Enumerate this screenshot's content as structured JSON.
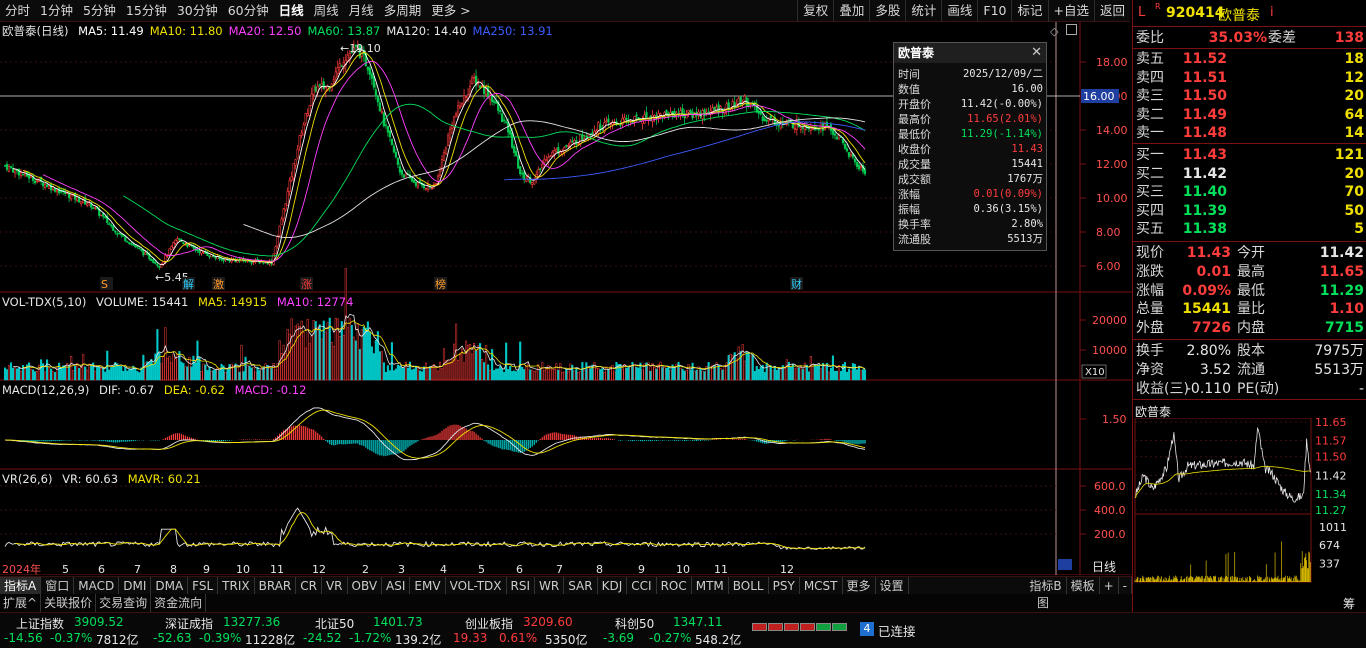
{
  "toolbar": {
    "periods": [
      "分时",
      "1分钟",
      "5分钟",
      "15分钟",
      "30分钟",
      "60分钟",
      "日线",
      "周线",
      "月线",
      "多周期",
      "更多 >"
    ],
    "active_period": "日线",
    "tools": [
      "复权",
      "叠加",
      "多股",
      "统计",
      "画线",
      "F10",
      "标记",
      "+自选",
      "返回"
    ]
  },
  "main": {
    "stock_label": "欧普泰(日线)",
    "ma": [
      {
        "label": "MA5: 11.49",
        "color": "#ffffff"
      },
      {
        "label": "MA10: 11.80",
        "color": "#f0e000"
      },
      {
        "label": "MA20: 12.50",
        "color": "#ff40ff"
      },
      {
        "label": "MA60: 13.87",
        "color": "#00e05a"
      },
      {
        "label": "MA120: 14.40",
        "color": "#e6e6e6"
      },
      {
        "label": "MA250: 13.91",
        "color": "#3b5bff"
      }
    ],
    "high_mark": "19.10",
    "low_mark": "5.45",
    "crosshair_price": "16.00",
    "y_ticks": [
      "18.00",
      "16.00",
      "14.00",
      "12.00",
      "10.00",
      "8.00",
      "6.00"
    ],
    "events": [
      "S",
      "解",
      "激",
      "涨",
      "榜",
      "财"
    ]
  },
  "volume": {
    "title": "VOL-TDX(5,10)",
    "values": [
      "VOLUME: 15441",
      "MA5: 14915",
      "MA10: 12774"
    ],
    "y_ticks": [
      "20000",
      "10000"
    ],
    "unit": "X10"
  },
  "macd": {
    "title": "MACD(12,26,9)",
    "values": [
      "DIF: -0.67",
      "DEA: -0.62",
      "MACD: -0.12"
    ],
    "y_ticks": [
      "1.50"
    ]
  },
  "vr": {
    "title": "VR(26,6)",
    "values": [
      "VR: 60.63",
      "MAVR: 60.21"
    ],
    "y_ticks": [
      "600.0",
      "400.0",
      "200.0"
    ],
    "period_label": "日线"
  },
  "x_axis": [
    "2024年",
    "5",
    "6",
    "7",
    "8",
    "9",
    "10",
    "11",
    "12",
    "2",
    "3",
    "4",
    "5",
    "6",
    "7",
    "8",
    "9",
    "10",
    "11",
    "12"
  ],
  "tooltip": {
    "title": "欧普泰",
    "rows": [
      {
        "k": "时间",
        "v": "2025/12/09/二",
        "c": "#e6e6e6"
      },
      {
        "k": "数值",
        "v": "16.00",
        "c": "#e6e6e6"
      },
      {
        "k": "开盘价",
        "v": "11.42(-0.00%)",
        "c": "#e6e6e6"
      },
      {
        "k": "最高价",
        "v": "11.65(2.01%)",
        "c": "#ff3c3c"
      },
      {
        "k": "最低价",
        "v": "11.29(-1.14%)",
        "c": "#00e05a"
      },
      {
        "k": "收盘价",
        "v": "11.43",
        "c": "#ff3c3c"
      },
      {
        "k": "成交量",
        "v": "15441",
        "c": "#e6e6e6"
      },
      {
        "k": "成交额",
        "v": "1767万",
        "c": "#e6e6e6"
      },
      {
        "k": "涨幅",
        "v": "0.01(0.09%)",
        "c": "#ff3c3c"
      },
      {
        "k": "振幅",
        "v": "0.36(3.15%)",
        "c": "#e6e6e6"
      },
      {
        "k": "换手率",
        "v": "2.80%",
        "c": "#e6e6e6"
      },
      {
        "k": "流通股",
        "v": "5513万",
        "c": "#e6e6e6"
      }
    ]
  },
  "indicator_tabs": [
    "指标A",
    "窗口",
    "MACD",
    "DMI",
    "DMA",
    "FSL",
    "TRIX",
    "BRAR",
    "CR",
    "VR",
    "OBV",
    "ASI",
    "EMV",
    "VOL-TDX",
    "RSI",
    "WR",
    "SAR",
    "KDJ",
    "CCI",
    "ROC",
    "MTM",
    "BOLL",
    "PSY",
    "MCST",
    "更多",
    "设置"
  ],
  "indicator_tabs_right": [
    "指标B",
    "模板",
    "+",
    "-"
  ],
  "ext_tabs": [
    "扩展^",
    "关联报价",
    "交易查询",
    "资金流向"
  ],
  "ext_right": "图",
  "indices": [
    {
      "name": "上证指数",
      "value": "3909.52",
      "chg": "-14.56",
      "pct": "-0.37%",
      "amt": "7812亿",
      "dir": "down"
    },
    {
      "name": "深证成指",
      "value": "13277.36",
      "chg": "-52.63",
      "pct": "-0.39%",
      "amt": "11228亿",
      "dir": "down"
    },
    {
      "name": "北证50",
      "value": "1401.73",
      "chg": "-24.52",
      "pct": "-1.72%",
      "amt": "139.2亿",
      "dir": "down"
    },
    {
      "name": "创业板指",
      "value": "3209.60",
      "chg": "19.33",
      "pct": "0.61%",
      "amt": "5350亿",
      "dir": "up"
    },
    {
      "name": "科创50",
      "value": "1347.11",
      "chg": "-3.69",
      "pct": "-0.27%",
      "amt": "548.2亿",
      "dir": "down"
    }
  ],
  "connection": {
    "count": "4",
    "text": "已连接"
  },
  "right_panel": {
    "mark": "L",
    "code": "920414",
    "name": "欧普泰",
    "info_icon": "i",
    "weibi_label": "委比",
    "weibi_value": "35.03%",
    "weicha_label": "委差",
    "weicha_value": "138",
    "asks": [
      {
        "label": "卖五",
        "price": "11.52",
        "vol": "18",
        "dir": "up"
      },
      {
        "label": "卖四",
        "price": "11.51",
        "vol": "12",
        "dir": "up"
      },
      {
        "label": "卖三",
        "price": "11.50",
        "vol": "20",
        "dir": "up"
      },
      {
        "label": "卖二",
        "price": "11.49",
        "vol": "64",
        "dir": "up"
      },
      {
        "label": "卖一",
        "price": "11.48",
        "vol": "14",
        "dir": "up"
      }
    ],
    "bids": [
      {
        "label": "买一",
        "price": "11.43",
        "vol": "121",
        "dir": "up"
      },
      {
        "label": "买二",
        "price": "11.42",
        "vol": "20",
        "dir": "flat"
      },
      {
        "label": "买三",
        "price": "11.40",
        "vol": "70",
        "dir": "down"
      },
      {
        "label": "买四",
        "price": "11.39",
        "vol": "50",
        "dir": "down"
      },
      {
        "label": "买五",
        "price": "11.38",
        "vol": "5",
        "dir": "down"
      }
    ],
    "quote": [
      {
        "l1": "现价",
        "v1": "11.43",
        "c1": "red",
        "l2": "今开",
        "v2": "11.42",
        "c2": "wht"
      },
      {
        "l1": "涨跌",
        "v1": "0.01",
        "c1": "red",
        "l2": "最高",
        "v2": "11.65",
        "c2": "red"
      },
      {
        "l1": "涨幅",
        "v1": "0.09%",
        "c1": "red",
        "l2": "最低",
        "v2": "11.29",
        "c2": "grn"
      },
      {
        "l1": "总量",
        "v1": "15441",
        "c1": "yel",
        "l2": "量比",
        "v2": "1.10",
        "c2": "red"
      },
      {
        "l1": "外盘",
        "v1": "7726",
        "c1": "red",
        "l2": "内盘",
        "v2": "7715",
        "c2": "grn"
      }
    ],
    "fin": [
      {
        "l1": "换手",
        "v1": "2.80%",
        "l2": "股本",
        "v2": "7975万"
      },
      {
        "l1": "净资",
        "v1": "3.52",
        "l2": "流通",
        "v2": "5513万"
      },
      {
        "l1": "收益(三)",
        "v1": "-0.110",
        "l2": "PE(动)",
        "v2": "-"
      }
    ],
    "mini_title": "欧普泰",
    "mini_price_ticks": [
      "11.65",
      "11.57",
      "11.50",
      "11.42",
      "11.34",
      "11.27"
    ],
    "mini_vol_ticks": [
      "1011",
      "674",
      "337"
    ],
    "footer_label": "筹"
  },
  "colors": {
    "up": "#ff3c3c",
    "down": "#00e05a",
    "flat": "#e6e6e6",
    "border": "#7a1010",
    "ma250": "#3b5bff"
  }
}
